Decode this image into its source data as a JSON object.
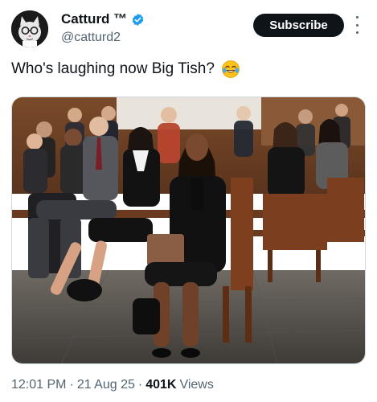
{
  "post": {
    "display_name": "Catturd ™",
    "handle": "@catturd2",
    "verified": true,
    "subscribe_label": "Subscribe",
    "text": "Who's laughing now Big Tish?",
    "emoji": "laughing-with-tears-emoji",
    "time": "12:01 PM",
    "separator": "·",
    "date": "21 Aug 25",
    "views_count": "401K",
    "views_label": "Views"
  },
  "icons": {
    "verified": "verified-badge-icon",
    "more": "more-options-icon"
  },
  "colors": {
    "text_primary": "#0f1419",
    "text_secondary": "#536471",
    "verified_blue": "#1d9bf0",
    "button_bg": "#0f1419"
  }
}
